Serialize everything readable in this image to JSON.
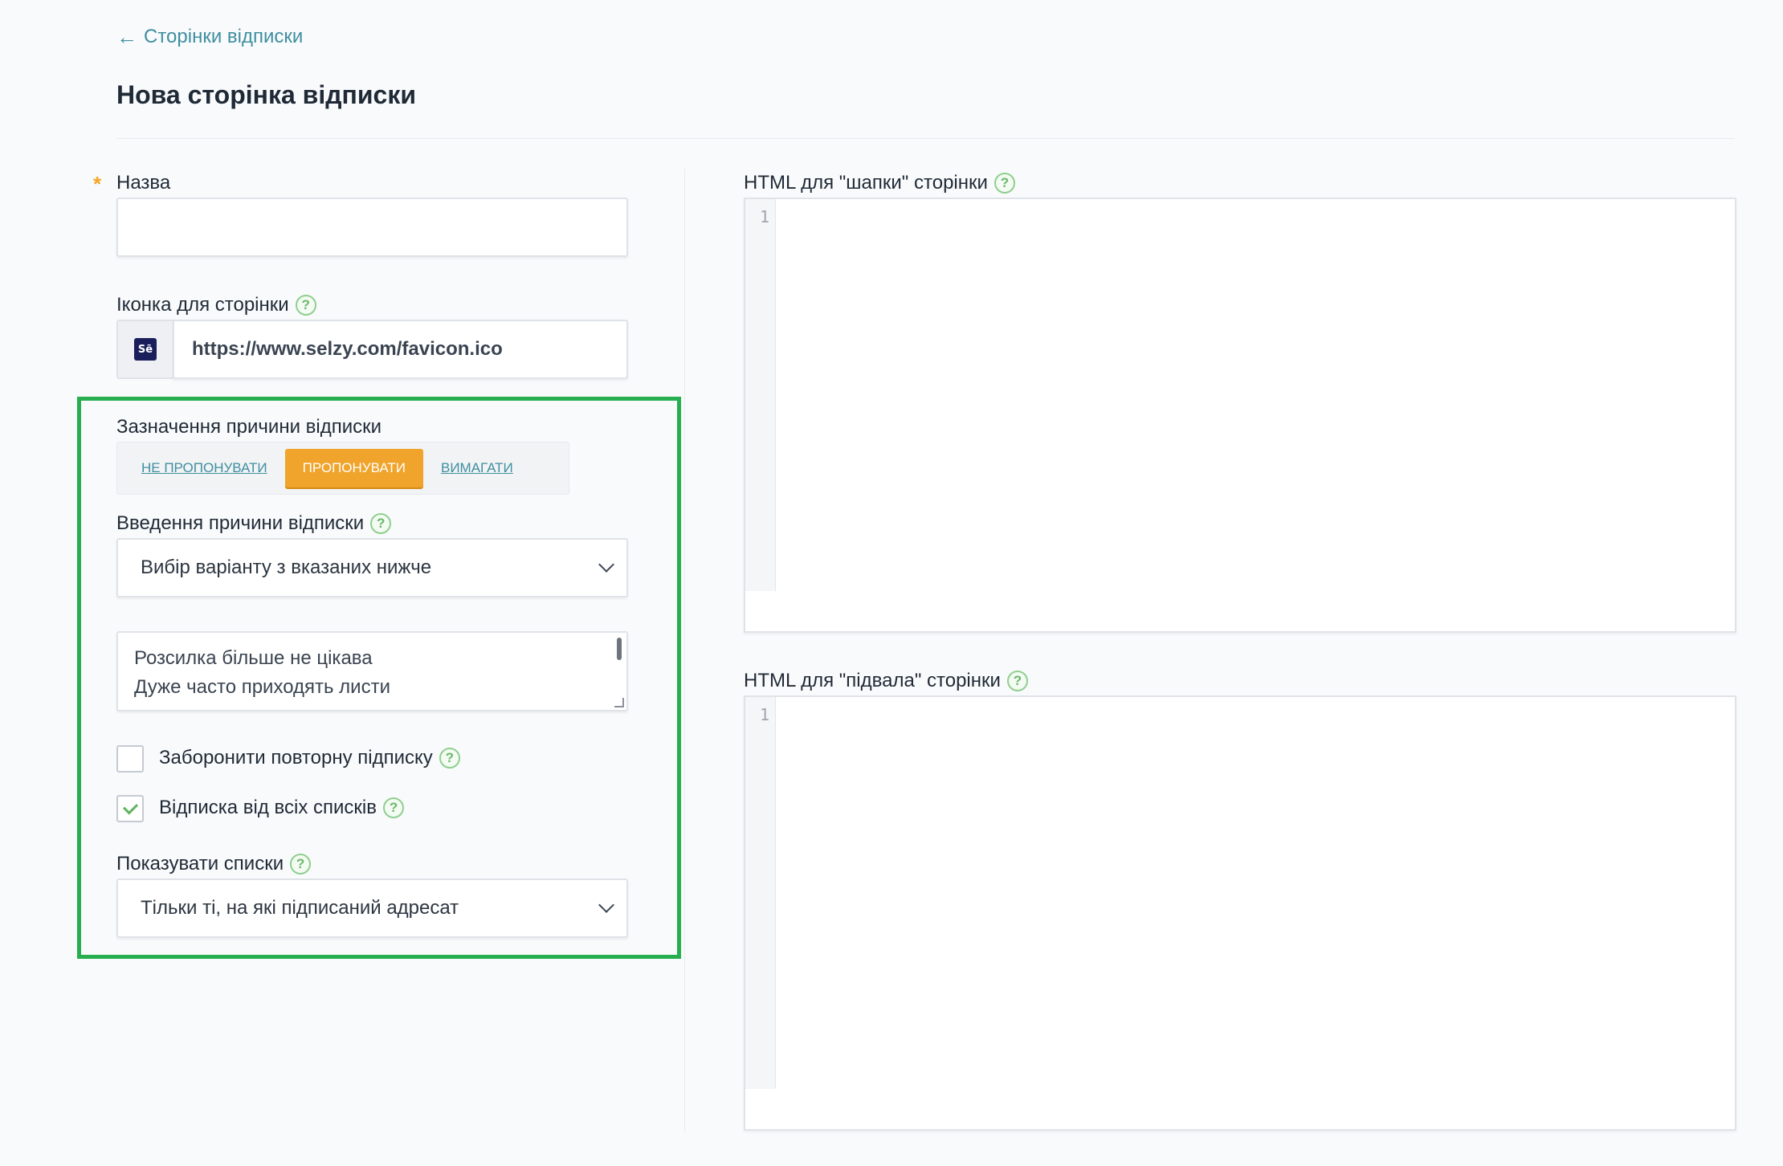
{
  "nav": {
    "back_arrow": "←",
    "back_label": "Сторінки відписки"
  },
  "page": {
    "title": "Нова сторінка відписки"
  },
  "form": {
    "name": {
      "required_mark": "*",
      "label": "Назва",
      "value": ""
    },
    "icon": {
      "label": "Іконка для сторінки",
      "favicon_text": "Sē",
      "url": "https://www.selzy.com/favicon.ico"
    },
    "reason_mode": {
      "label": "Зазначення причини відписки",
      "options": [
        "НЕ ПРОПОНУВАТИ",
        "ПРОПОНУВАТИ",
        "ВИМАГАТИ"
      ],
      "selected": "ПРОПОНУВАТИ"
    },
    "reason_input": {
      "label": "Введення причини відписки",
      "selected": "Вибір варіанту з вказаних нижче"
    },
    "reasons": {
      "items": [
        "Розсилка більше не цікава",
        "Дуже часто приходять листи"
      ]
    },
    "forbid_resubscribe": {
      "label": "Заборонити повторну підписку",
      "checked": false
    },
    "unsubscribe_all": {
      "label": "Відписка від всіх списків",
      "checked": true
    },
    "show_lists": {
      "label": "Показувати списки",
      "selected": "Тільки ті, на які підписаний адресат"
    }
  },
  "editors": {
    "header": {
      "label": "HTML для \"шапки\" сторінки",
      "line_number": "1"
    },
    "footer": {
      "label": "HTML для \"підвала\" сторінки",
      "line_number": "1"
    }
  },
  "help_glyph": "?",
  "colors": {
    "accent_orange": "#f0a42b",
    "link": "#3f8fa0",
    "highlight_green": "#27ae4f",
    "help_green": "#8fcf8f"
  }
}
